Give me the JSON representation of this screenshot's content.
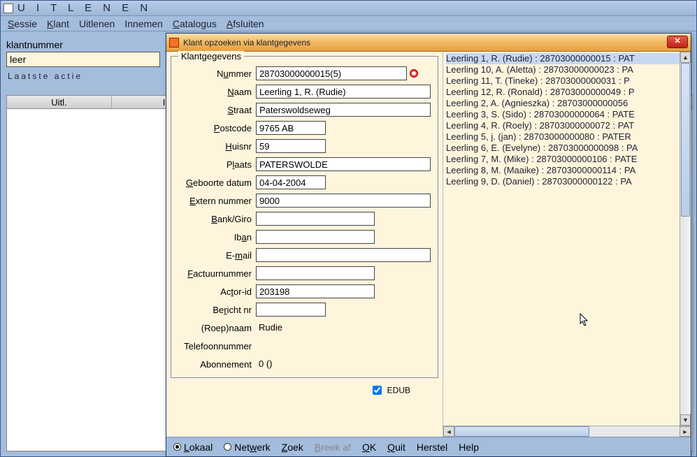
{
  "main": {
    "title": "U I T L E N E N",
    "menu": [
      "Sessie",
      "Klant",
      "Uitlenen",
      "Innemen",
      "Catalogus",
      "Afsluiten"
    ],
    "form": {
      "klantnummer_label": "klantnummer",
      "klantnummer_value": "leer",
      "laatste_actie_label": "Laatste actie"
    },
    "grid_headers": [
      "Uitl.",
      "I"
    ]
  },
  "dialog": {
    "title": "Klant opzoeken via klantgegevens",
    "fieldset_legend": "Klantgegevens",
    "fields": {
      "nummer_label": "Nummer",
      "nummer_value": "28703000000015(5)",
      "naam_label": "Naam",
      "naam_value": "Leerling 1, R. (Rudie)",
      "straat_label": "Straat",
      "straat_value": "Paterswoldseweg",
      "postcode_label": "Postcode",
      "postcode_value": "9765 AB",
      "huisnr_label": "Huisnr",
      "huisnr_value": "59",
      "plaats_label": "Plaats",
      "plaats_value": "PATERSWOLDE",
      "geboorte_label": "Geboorte datum",
      "geboorte_value": "04-04-2004",
      "extern_label": "Extern nummer",
      "extern_value": "9000",
      "bankgiro_label": "Bank/Giro",
      "bankgiro_value": "",
      "iban_label": "Iban",
      "iban_value": "",
      "email_label": "E-mail",
      "email_value": "",
      "factuur_label": "Factuurnummer",
      "factuur_value": "",
      "actor_label": "Actor-id",
      "actor_value": "203198",
      "bericht_label": "Bericht nr",
      "bericht_value": "",
      "roepnaam_label": "(Roep)naam",
      "roepnaam_value": "Rudie",
      "telefoon_label": "Telefoonnummer",
      "telefoon_value": "",
      "abonnement_label": "Abonnement",
      "abonnement_value": "0 ()"
    },
    "edub_label": "EDUB",
    "edub_checked": true,
    "list": [
      "Leerling 1, R. (Rudie) : 28703000000015 : PAT",
      "Leerling 10, A. (Aletta) : 28703000000023 : PA",
      "Leerling 11, T. (Tineke) : 28703000000031 : P",
      "Leerling 12, R. (Ronald) : 28703000000049 : P",
      "Leerling 2, A. (Agnieszka) : 28703000000056",
      "Leerling 3, S. (Sido) : 28703000000064 : PATE",
      "Leerling 4, R. (Roely) : 28703000000072 : PAT",
      "Leerling 5, j. (jan) : 28703000000080 : PATER",
      "Leerling 6, E. (Evelyne) : 28703000000098 : PA",
      "Leerling 7, M. (Mike) : 28703000000106 : PATE",
      "Leerling 8, M. (Maaike) : 28703000000114 : PA",
      "Leerling 9, D. (Daniel) : 28703000000122 : PA"
    ],
    "list_selected_index": 0,
    "bottom": {
      "lokaal_label": "Lokaal",
      "netwerk_label": "Netwerk",
      "zoek_label": "Zoek",
      "breekaf_label": "Breek af",
      "ok_label": "OK",
      "quit_label": "Quit",
      "herstel_label": "Herstel",
      "help_label": "Help"
    }
  }
}
